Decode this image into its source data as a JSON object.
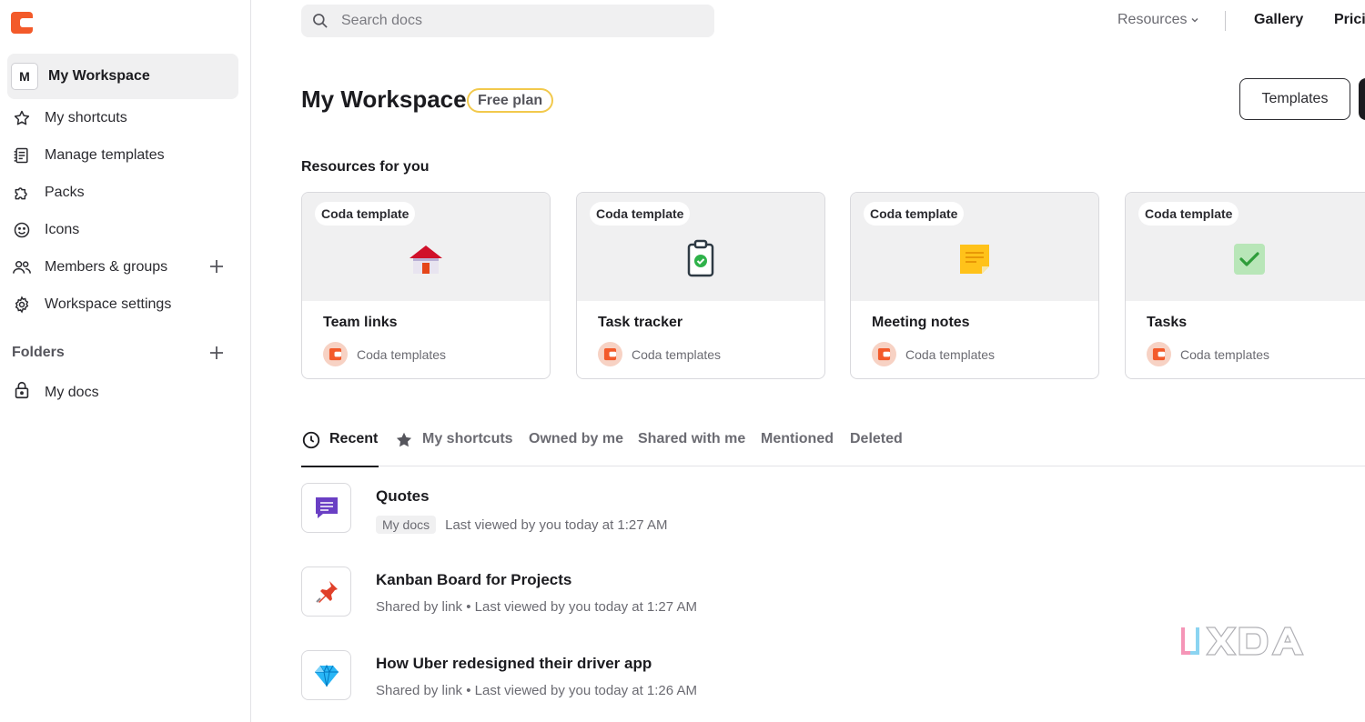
{
  "sidebar": {
    "workspace": {
      "avatar_letter": "M",
      "name": "My Workspace"
    },
    "items": [
      {
        "label": "My shortcuts",
        "icon": "star-icon"
      },
      {
        "label": "Manage templates",
        "icon": "templates-icon"
      },
      {
        "label": "Packs",
        "icon": "puzzle-icon"
      },
      {
        "label": "Icons",
        "icon": "smiley-icon"
      },
      {
        "label": "Members & groups",
        "icon": "people-icon"
      },
      {
        "label": "Workspace settings",
        "icon": "gear-icon"
      }
    ],
    "folders_label": "Folders",
    "folders": [
      {
        "label": "My docs",
        "icon": "lock-icon"
      }
    ]
  },
  "topbar": {
    "search_placeholder": "Search docs",
    "resources_label": "Resources",
    "gallery_label": "Gallery",
    "pricing_label": "Pricin"
  },
  "header": {
    "title": "My Workspace",
    "plan_badge": "Free plan",
    "templates_button": "Templates"
  },
  "resources": {
    "title": "Resources for you",
    "cards": [
      {
        "tag": "Coda template",
        "title": "Team links",
        "author": "Coda templates",
        "icon": "house-icon"
      },
      {
        "tag": "Coda template",
        "title": "Task tracker",
        "author": "Coda templates",
        "icon": "clipboard-check-icon"
      },
      {
        "tag": "Coda template",
        "title": "Meeting notes",
        "author": "Coda templates",
        "icon": "sticky-note-icon"
      },
      {
        "tag": "Coda template",
        "title": "Tasks",
        "author": "Coda templates",
        "icon": "checkbox-icon"
      }
    ]
  },
  "tabs": [
    {
      "label": "Recent",
      "active": true,
      "icon": "clock-icon"
    },
    {
      "label": "My shortcuts",
      "active": false,
      "icon": "star-filled-icon"
    },
    {
      "label": "Owned by me",
      "active": false
    },
    {
      "label": "Shared with me",
      "active": false
    },
    {
      "label": "Mentioned",
      "active": false
    },
    {
      "label": "Deleted",
      "active": false
    }
  ],
  "docs": [
    {
      "title": "Quotes",
      "folder": "My docs",
      "meta": "Last viewed by you today at 1:27 AM",
      "icon": "speech-bubble-icon"
    },
    {
      "title": "Kanban Board for Projects",
      "meta": "Shared by link • Last viewed by you today at 1:27 AM",
      "icon": "pushpin-icon"
    },
    {
      "title": "How Uber redesigned their driver app",
      "meta": "Shared by link • Last viewed by you today at 1:26 AM",
      "icon": "gem-icon"
    }
  ],
  "colors": {
    "brand": "#f35a2a",
    "plan_badge_border": "#f2c94c",
    "sidebar_active_bg": "#f0f0f1"
  }
}
